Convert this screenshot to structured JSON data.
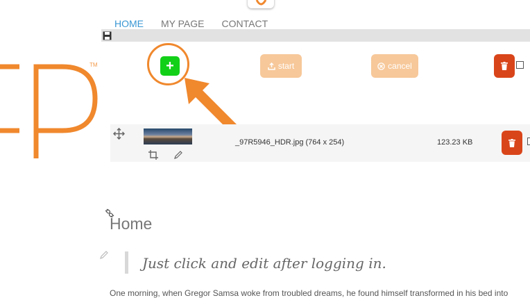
{
  "nav": {
    "items": [
      {
        "label": "HOME",
        "active": true
      },
      {
        "label": "MY PAGE",
        "active": false
      },
      {
        "label": "CONTACT",
        "active": false
      }
    ]
  },
  "logo": {
    "tm": "TM",
    "brand_color": "#f0882d"
  },
  "upload": {
    "add_label": "+",
    "start_label": "start",
    "cancel_label": "cancel"
  },
  "file": {
    "name": "_97R5946_HDR.jpg (764 x 254)",
    "size": "123.23 KB"
  },
  "content": {
    "title": "Home",
    "quote": "Just click and edit after logging in.",
    "body": "One morning, when Gregor Samsa woke from troubled dreams, he found himself transformed in his bed into"
  },
  "colors": {
    "accent": "#f0882d",
    "add_green": "#12d018",
    "delete_red": "#d9451a",
    "nav_active": "#3a97d4"
  }
}
